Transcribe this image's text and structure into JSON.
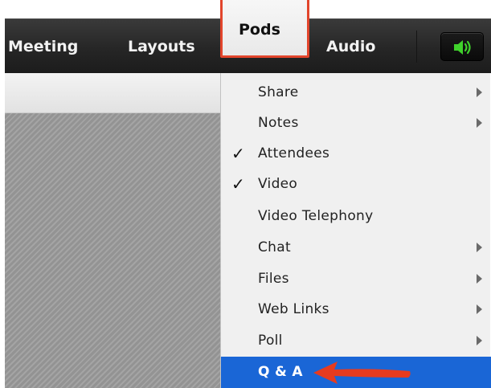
{
  "menubar": {
    "items": [
      {
        "label": "Meeting"
      },
      {
        "label": "Layouts"
      },
      {
        "label": "Pods"
      },
      {
        "label": "Audio"
      }
    ],
    "speaker_icon": "speaker-icon",
    "speaker_color": "#3fd22b"
  },
  "pods_menu": {
    "items": [
      {
        "label": "Share",
        "checked": false,
        "submenu": true
      },
      {
        "label": "Notes",
        "checked": false,
        "submenu": true
      },
      {
        "label": "Attendees",
        "checked": true,
        "submenu": false
      },
      {
        "label": "Video",
        "checked": true,
        "submenu": false
      },
      {
        "label": "Video Telephony",
        "checked": false,
        "submenu": false
      },
      {
        "label": "Chat",
        "checked": false,
        "submenu": true
      },
      {
        "label": "Files",
        "checked": false,
        "submenu": true
      },
      {
        "label": "Web Links",
        "checked": false,
        "submenu": true
      },
      {
        "label": "Poll",
        "checked": false,
        "submenu": true
      },
      {
        "label": "Q & A",
        "checked": false,
        "submenu": false,
        "selected": true
      }
    ],
    "check_glyph": "✓"
  },
  "colors": {
    "highlight_border": "#e2452c",
    "selected_row": "#1a66d6",
    "annotation_arrow": "#e63b1f"
  }
}
